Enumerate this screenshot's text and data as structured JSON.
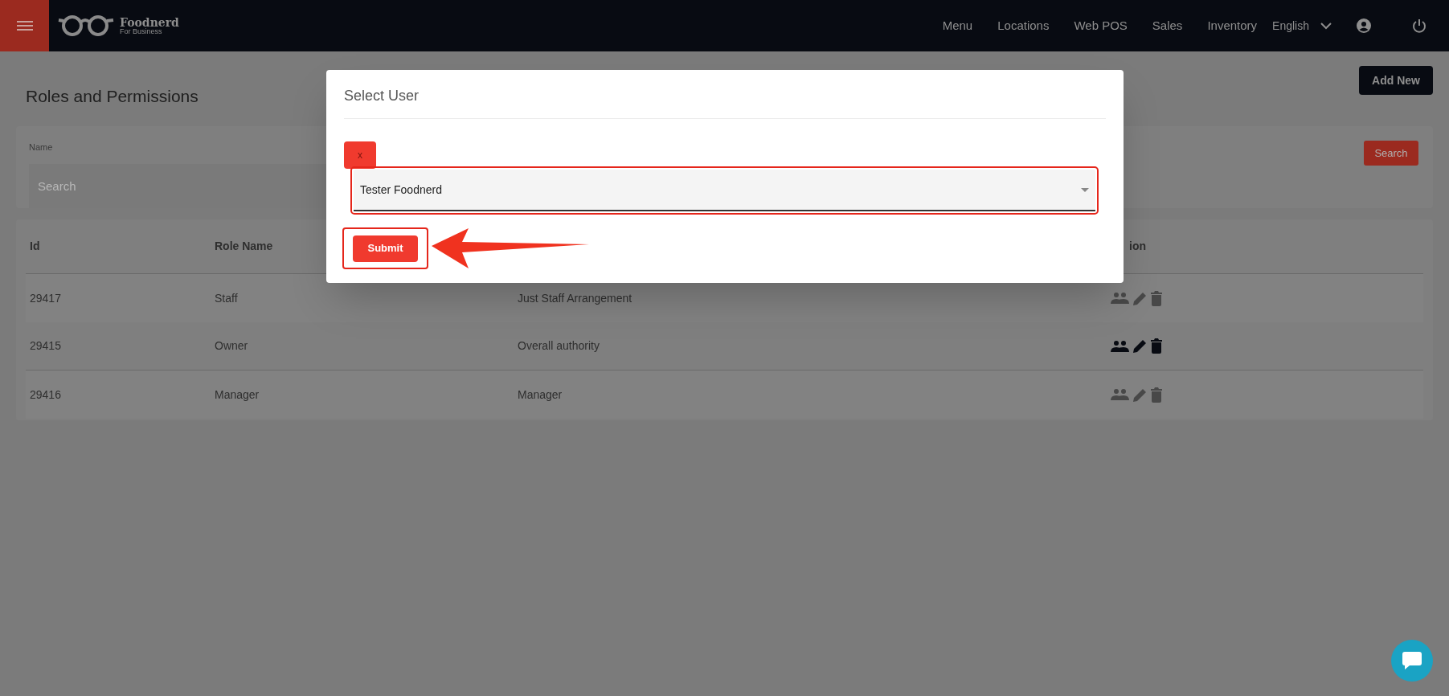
{
  "navbar": {
    "brand": "Foodnerd",
    "brand_sub": "For Business",
    "links": [
      "Menu",
      "Locations",
      "Web POS",
      "Sales",
      "Inventory"
    ],
    "language": "English"
  },
  "page": {
    "title": "Roles and Permissions",
    "add_button": "Add New"
  },
  "filter": {
    "label": "Name",
    "placeholder": "Search",
    "button": "Search"
  },
  "table": {
    "columns": [
      "Id",
      "Role Name",
      "ion"
    ],
    "rows": [
      {
        "id": "29417",
        "role": "Staff",
        "description": "Just Staff Arrangement",
        "hovered": false
      },
      {
        "id": "29415",
        "role": "Owner",
        "description": "Overall authority",
        "hovered": true
      },
      {
        "id": "29416",
        "role": "Manager",
        "description": "Manager",
        "hovered": false
      }
    ]
  },
  "modal": {
    "title": "Select User",
    "clear": "x",
    "value": "Tester Foodnerd",
    "submit": "Submit"
  }
}
